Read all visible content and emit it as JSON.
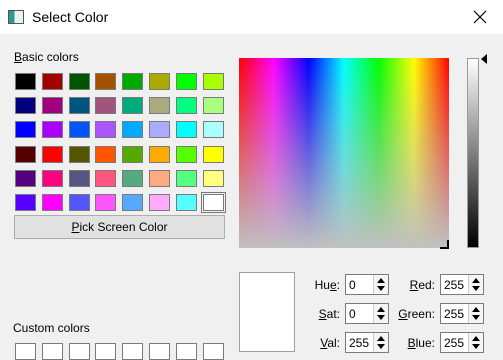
{
  "window": {
    "title": "Select Color",
    "icon": "app-icon",
    "close_icon": "close-icon"
  },
  "basic": {
    "label": "Basic colors",
    "colors": [
      [
        "#000000",
        "#a30000",
        "#005500",
        "#a35200",
        "#00aa00",
        "#aaaa00",
        "#00ff00",
        "#aaff00"
      ],
      [
        "#00007f",
        "#a0007f",
        "#00557f",
        "#a0557f",
        "#00aa7f",
        "#aaaa7f",
        "#00ff7f",
        "#aaff7f"
      ],
      [
        "#0000ff",
        "#aa00ff",
        "#0055ff",
        "#aa55ff",
        "#00aaff",
        "#aaaaff",
        "#00ffff",
        "#aaffff"
      ],
      [
        "#550000",
        "#ff0000",
        "#555500",
        "#ff5500",
        "#55aa00",
        "#ffaa00",
        "#55ff00",
        "#ffff00"
      ],
      [
        "#55007f",
        "#ff007f",
        "#55557f",
        "#ff557f",
        "#55aa7f",
        "#ffaa7f",
        "#55ff7f",
        "#ffff7f"
      ],
      [
        "#5500ff",
        "#ff00ff",
        "#5555ff",
        "#ff55ff",
        "#55aaff",
        "#ffaaff",
        "#55ffff",
        "#ffffff"
      ]
    ]
  },
  "pick_button": {
    "label": "Pick Screen Color"
  },
  "custom": {
    "label": "Custom colors"
  },
  "fields": {
    "hue": {
      "label": "Hue:",
      "value": "0"
    },
    "sat": {
      "label": "Sat:",
      "value": "0"
    },
    "val": {
      "label": "Val:",
      "value": "255"
    },
    "red": {
      "label": "Red:",
      "value": "255"
    },
    "green": {
      "label": "Green:",
      "value": "255"
    },
    "blue": {
      "label": "Blue:",
      "value": "255"
    }
  },
  "current_color": "#ffffff"
}
